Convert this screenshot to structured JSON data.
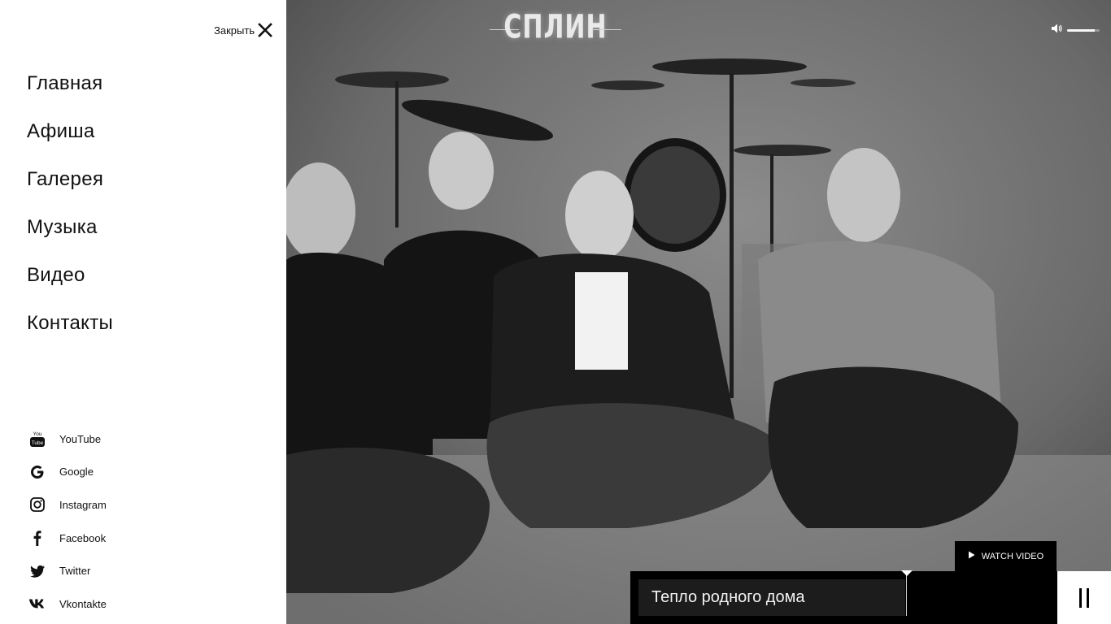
{
  "menu": {
    "close_label": "Закрыть",
    "nav_items": [
      {
        "label": "Главная"
      },
      {
        "label": "Афиша"
      },
      {
        "label": "Галерея"
      },
      {
        "label": "Музыка"
      },
      {
        "label": "Видео"
      },
      {
        "label": "Контакты"
      }
    ],
    "social": [
      {
        "label": "YouTube",
        "icon": "youtube-icon"
      },
      {
        "label": "Google",
        "icon": "google-icon"
      },
      {
        "label": "Instagram",
        "icon": "instagram-icon"
      },
      {
        "label": "Facebook",
        "icon": "facebook-icon"
      },
      {
        "label": "Twitter",
        "icon": "twitter-icon"
      },
      {
        "label": "Vkontakte",
        "icon": "vkontakte-icon"
      }
    ]
  },
  "hero": {
    "logo_text": "СПЛИН",
    "watch_video_label": "WATCH VIDEO",
    "volume_level": 0.85
  },
  "player": {
    "track_title": "Тепло родного дома"
  },
  "colors": {
    "panel_bg": "#ffffff",
    "text": "#111111",
    "player_bg": "#000000",
    "track_bg": "#1c1c1c"
  }
}
